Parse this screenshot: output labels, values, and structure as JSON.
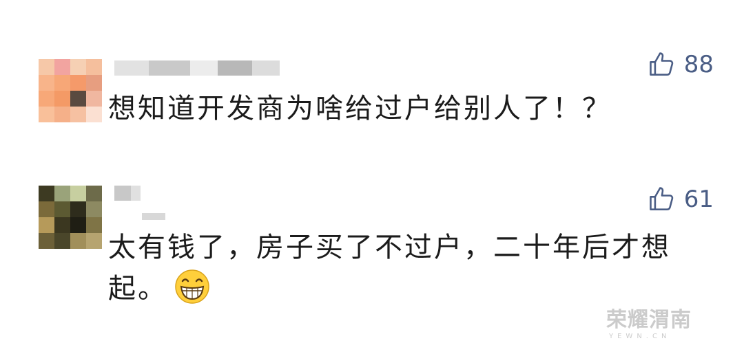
{
  "comments": [
    {
      "like_icon": "thumbs-up-outline-icon",
      "likes": "88",
      "text": "想知道开发商为啥给过户给别人了！？"
    },
    {
      "like_icon": "thumbs-up-outline-icon",
      "likes": "61",
      "text": "太有钱了，房子买了不过户，二十年后才想起。",
      "emoji": "grinning-face-emoji"
    }
  ],
  "watermark": {
    "title": "荣耀渭南",
    "subtitle": "YEWN.CN"
  },
  "colors": {
    "like_color": "#4a5d85",
    "text_color": "#1b1b1b"
  }
}
